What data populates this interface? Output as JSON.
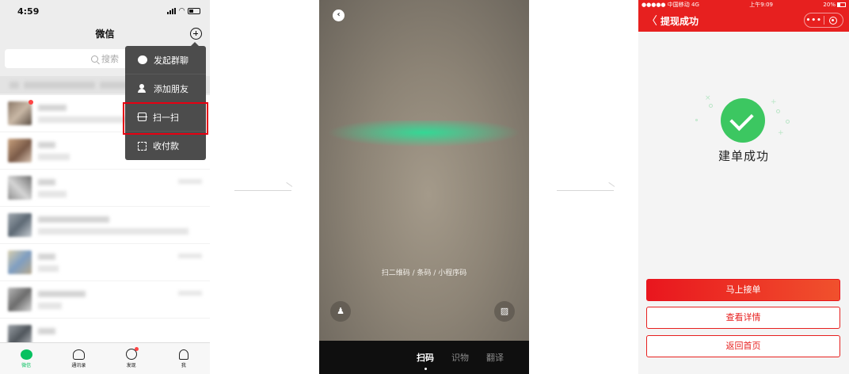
{
  "phone1": {
    "status_time": "4:59",
    "nav_title": "微信",
    "search_placeholder": "搜索",
    "menu_items": [
      {
        "label": "发起群聊",
        "icon": "group-chat-icon"
      },
      {
        "label": "添加朋友",
        "icon": "add-friend-icon"
      },
      {
        "label": "扫一扫",
        "icon": "scan-icon"
      },
      {
        "label": "收付款",
        "icon": "money-icon"
      }
    ],
    "highlighted_item": "扫一扫",
    "highlight_color": "#e60012",
    "tabs": [
      {
        "label": "微信",
        "icon": "chats-icon",
        "active": true
      },
      {
        "label": "通讯录",
        "icon": "contacts-icon",
        "active": false
      },
      {
        "label": "发现",
        "icon": "discover-icon",
        "active": false
      },
      {
        "label": "我",
        "icon": "me-icon",
        "active": false
      }
    ],
    "accent_color": "#07c160"
  },
  "phone2": {
    "scan_hint": "扫二维码 / 条码 / 小程序码",
    "scan_line_color": "#2edc96",
    "bottom_tabs": [
      {
        "label": "扫码",
        "active": true
      },
      {
        "label": "识物",
        "active": false
      },
      {
        "label": "翻译",
        "active": false
      }
    ]
  },
  "phone3": {
    "status_left": "●●●●● 中国移动  4G",
    "status_center": "上午9:09",
    "status_right": "20%",
    "nav_title": "提现成功",
    "success_text": "建单成功",
    "buttons": {
      "primary": "马上接单",
      "details": "查看详情",
      "home": "返回首页"
    },
    "brand_color": "#e7201f",
    "success_color": "#3cc761"
  }
}
